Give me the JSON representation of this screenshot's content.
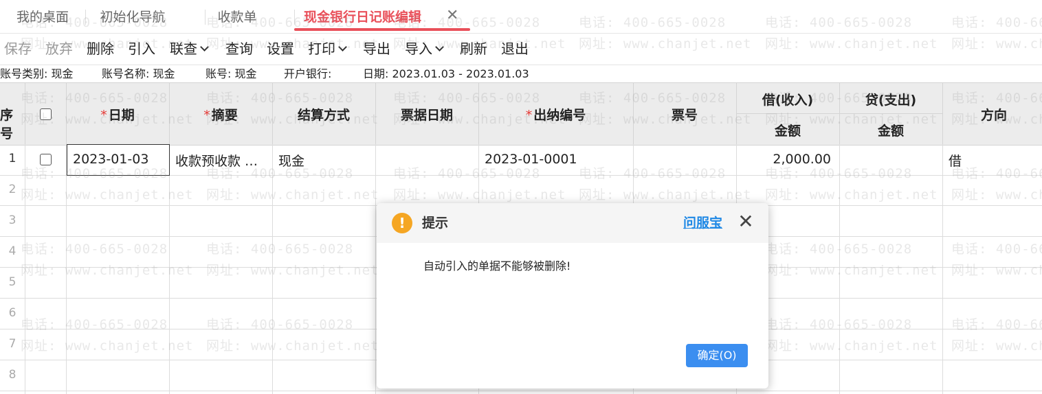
{
  "tabs": [
    {
      "label": "我的桌面"
    },
    {
      "label": "初始化导航"
    },
    {
      "label": "收款单"
    },
    {
      "label": "现金银行日记账编辑",
      "active": true
    }
  ],
  "tab_close_symbol": "✕",
  "toolbar": {
    "save": "保存",
    "discard": "放弃",
    "delete": "删除",
    "import_in": "引入",
    "linked_query": "联查",
    "query": "查询",
    "settings": "设置",
    "print": "打印",
    "export": "导出",
    "import": "导入",
    "refresh": "刷新",
    "exit": "退出"
  },
  "info": {
    "account_type": "账号类别: 现金",
    "account_name": "账号名称: 现金",
    "account_no": "账号: 现金",
    "bank": "开户银行:",
    "date_range": "日期: 2023.01.03 - 2023.01.03"
  },
  "columns": {
    "seq": "序号",
    "date": "日期",
    "summary": "摘要",
    "settle": "结算方式",
    "bill_date": "票据日期",
    "cashier_no": "出纳编号",
    "ticket_no": "票号",
    "debit": "借(收入)",
    "debit_amount": "金额",
    "credit": "贷(支出)",
    "credit_amount": "金额",
    "direction": "方向",
    "required_mark": "*"
  },
  "rows": [
    {
      "num": "1",
      "date": "2023-01-03",
      "summary": "收款预收款 …",
      "settle": "现金",
      "bill_date": "",
      "cashier_no": "2023-01-0001",
      "ticket_no": "",
      "debit": "2,000.00",
      "credit": "",
      "direction": "借"
    },
    {
      "num": "2"
    },
    {
      "num": "3"
    },
    {
      "num": "4"
    },
    {
      "num": "5"
    },
    {
      "num": "6"
    },
    {
      "num": "7"
    },
    {
      "num": "8"
    }
  ],
  "watermark": {
    "phone": "电话: 400-665-0028",
    "site": "网址: www.chanjet.net"
  },
  "dialog": {
    "icon": "warning-icon",
    "icon_glyph": "!",
    "title": "提示",
    "help_link": "问服宝",
    "close_symbol": "✕",
    "message": "自动引入的单据不能够被删除!",
    "ok_label": "确定(O)"
  },
  "colors": {
    "accent": "#e9505a",
    "primary_button": "#3b8ef0",
    "link": "#1e88e5",
    "warning": "#f5a623",
    "required": "#e53935"
  }
}
